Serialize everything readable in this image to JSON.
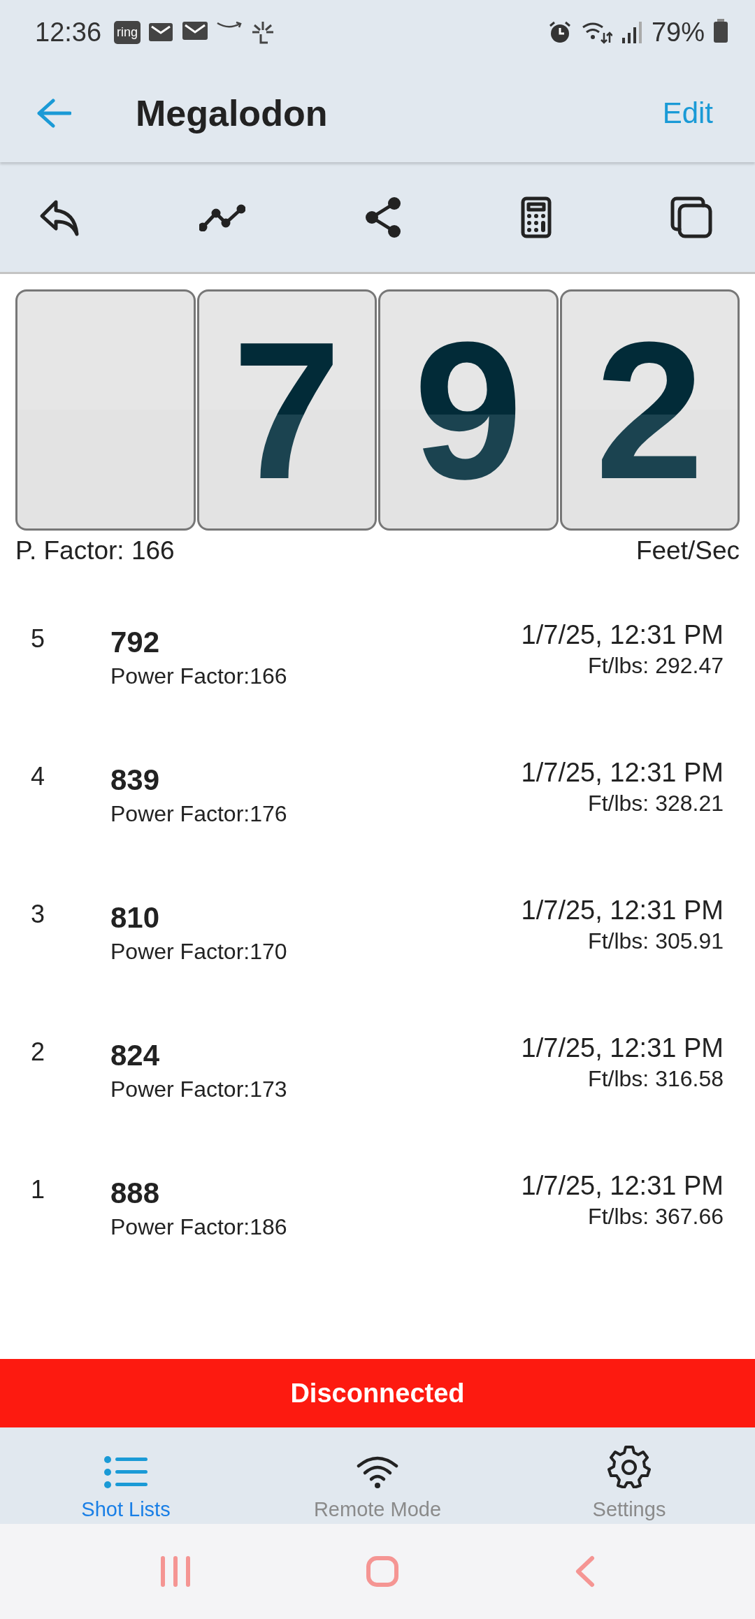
{
  "status_bar": {
    "time": "12:36",
    "notification_badge": "ring",
    "battery": "79%"
  },
  "header": {
    "title": "Megalodon",
    "action": "Edit"
  },
  "display": {
    "digits": [
      {
        "kind": "blank"
      },
      {
        "kind": "digit",
        "text": "7"
      },
      {
        "kind": "digit",
        "text": "9"
      },
      {
        "kind": "digit",
        "text": "2"
      }
    ],
    "power_factor": "P. Factor: 166",
    "unit": "Feet/Sec"
  },
  "shots": [
    {
      "index": "5",
      "velocity": "792",
      "power_factor": "Power Factor:166",
      "time": "1/7/25, 12:31 PM",
      "energy": "Ft/lbs: 292.47"
    },
    {
      "index": "4",
      "velocity": "839",
      "power_factor": "Power Factor:176",
      "time": "1/7/25, 12:31 PM",
      "energy": "Ft/lbs: 328.21"
    },
    {
      "index": "3",
      "velocity": "810",
      "power_factor": "Power Factor:170",
      "time": "1/7/25, 12:31 PM",
      "energy": "Ft/lbs: 305.91"
    },
    {
      "index": "2",
      "velocity": "824",
      "power_factor": "Power Factor:173",
      "time": "1/7/25, 12:31 PM",
      "energy": "Ft/lbs: 316.58"
    },
    {
      "index": "1",
      "velocity": "888",
      "power_factor": "Power Factor:186",
      "time": "1/7/25, 12:31 PM",
      "energy": "Ft/lbs: 367.66"
    }
  ],
  "connection_banner": "Disconnected",
  "tabs": [
    {
      "label": "Shot Lists",
      "selected": true
    },
    {
      "label": "Remote Mode",
      "selected": false
    },
    {
      "label": "Settings",
      "selected": false
    }
  ]
}
